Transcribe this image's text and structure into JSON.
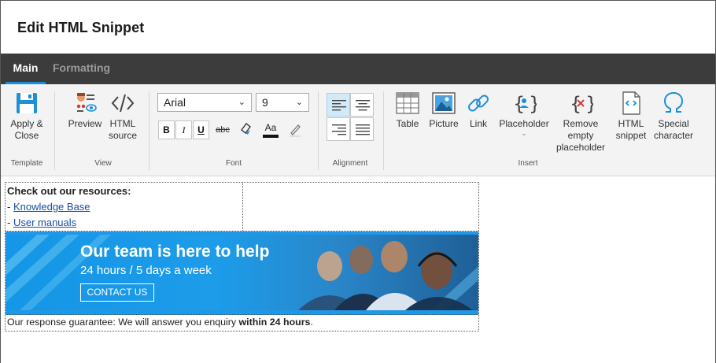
{
  "dialog": {
    "title": "Edit HTML Snippet"
  },
  "tabs": [
    {
      "label": "Main",
      "active": true
    },
    {
      "label": "Formatting",
      "active": false
    }
  ],
  "ribbon": {
    "template": {
      "group_label": "Template",
      "apply_close": "Apply &\nClose"
    },
    "view": {
      "group_label": "View",
      "preview": "Preview",
      "html_source": "HTML\nsource"
    },
    "font": {
      "group_label": "Font",
      "family": "Arial",
      "size": "9",
      "bold": "B",
      "italic": "I",
      "underline": "U",
      "strike": "abc",
      "case": "Aa"
    },
    "alignment": {
      "group_label": "Alignment"
    },
    "insert": {
      "group_label": "Insert",
      "table": "Table",
      "picture": "Picture",
      "link": "Link",
      "placeholder": "Placeholder",
      "remove_empty": "Remove\nempty\nplaceholder",
      "html_snippet": "HTML\nsnippet",
      "special_char": "Special\ncharacter"
    }
  },
  "snippet": {
    "heading": "Check out our resources:",
    "links": [
      "Knowledge Base",
      "User manuals"
    ],
    "link_prefix": "- ",
    "banner": {
      "headline": "Our team is here to help",
      "subline": "24 hours / 5 days a week",
      "cta": "CONTACT US"
    },
    "guarantee_prefix": "Our response guarantee: We will answer you enquiry ",
    "guarantee_bold": "within 24 hours",
    "guarantee_suffix": "."
  },
  "colors": {
    "accent": "#1d8ddb",
    "tabbar": "#3c3c3c",
    "banner": "#1c9ce9",
    "link": "#1a4fa0"
  }
}
